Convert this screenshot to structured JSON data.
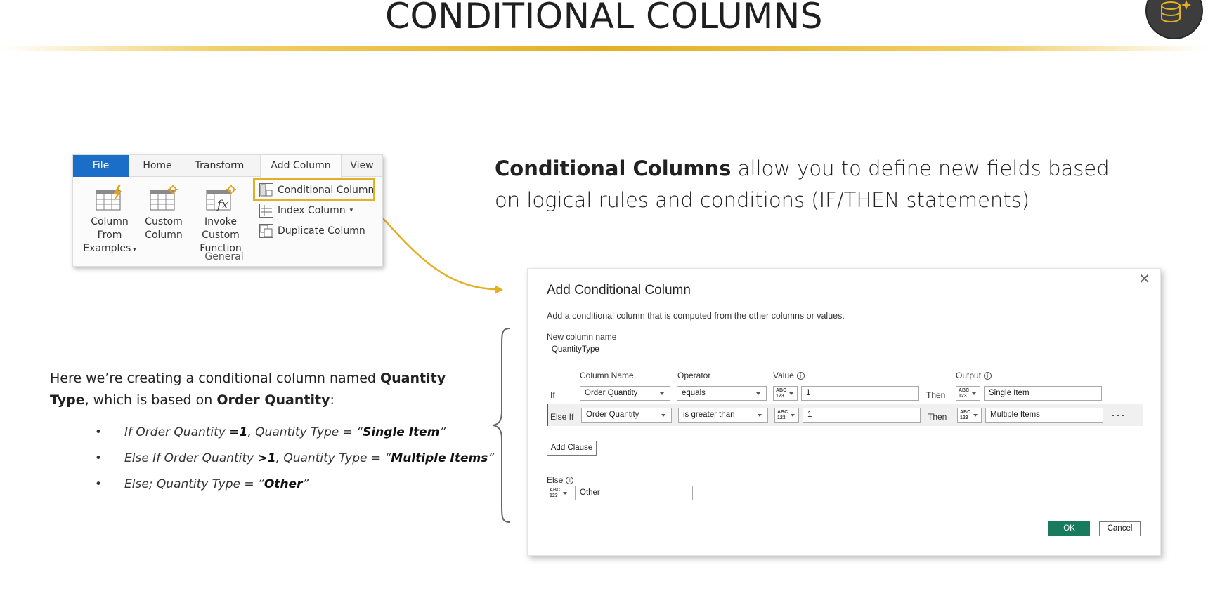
{
  "slide": {
    "title": "CONDITIONAL COLUMNS"
  },
  "ribbon": {
    "tabs": [
      "File",
      "Home",
      "Transform",
      "Add Column",
      "View"
    ],
    "active_tab": "Add Column",
    "big_buttons": [
      {
        "line1": "Column From",
        "line2": "Examples",
        "icon": "table-lightning-icon"
      },
      {
        "line1": "Custom",
        "line2": "Column",
        "icon": "table-star-icon"
      },
      {
        "line1": "Invoke Custom",
        "line2": "Function",
        "icon": "table-fx-icon"
      }
    ],
    "small_buttons": [
      {
        "label": "Conditional Column",
        "icon": "conditional-column-icon"
      },
      {
        "label": "Index Column",
        "icon": "index-column-icon"
      },
      {
        "label": "Duplicate Column",
        "icon": "duplicate-column-icon"
      }
    ],
    "group_label": "General"
  },
  "description": {
    "bold": "Conditional Columns",
    "rest": " allow you to define new fields based on logical rules and conditions (IF/THEN statements)"
  },
  "explanation": {
    "p1": "Here we’re creating a conditional column named ",
    "b1": "Quantity Type",
    "p2": ", which is based on ",
    "b2": "Order Quantity",
    "p3": ":"
  },
  "bullets": [
    {
      "a": "If Order Quantity ",
      "b": "=1",
      "c": ", Quantity Type = “",
      "d": "Single Item",
      "e": "”"
    },
    {
      "a": "Else If Order Quantity ",
      "b": ">1",
      "c": ", Quantity Type = “",
      "d": "Multiple Items",
      "e": "”"
    },
    {
      "a": "Else; Quantity Type = “",
      "b": "",
      "c": "",
      "d": "Other",
      "e": "”"
    }
  ],
  "dialog": {
    "title": "Add Conditional Column",
    "close": "✕",
    "subtitle": "Add a conditional column that is computed from the other columns or values.",
    "new_column_label": "New column name",
    "new_column_value": "QuantityType",
    "headers": {
      "column_name": "Column Name",
      "operator": "Operator",
      "value": "Value",
      "output": "Output"
    },
    "type_label_top": "ABC",
    "type_label_bottom": "123",
    "rows": [
      {
        "prefix": "If",
        "column": "Order Quantity",
        "operator": "equals",
        "value": "1",
        "then": "Then",
        "output": "Single Item"
      },
      {
        "prefix": "Else If",
        "column": "Order Quantity",
        "operator": "is greater than",
        "value": "1",
        "then": "Then",
        "output": "Multiple Items"
      }
    ],
    "more": "···",
    "add_clause": "Add Clause",
    "else_label": "Else",
    "else_value": "Other",
    "ok": "OK",
    "cancel": "Cancel"
  },
  "colors": {
    "accent": "#e2b023",
    "file_tab": "#1a6ec7",
    "ok_button": "#1a7a5e"
  }
}
